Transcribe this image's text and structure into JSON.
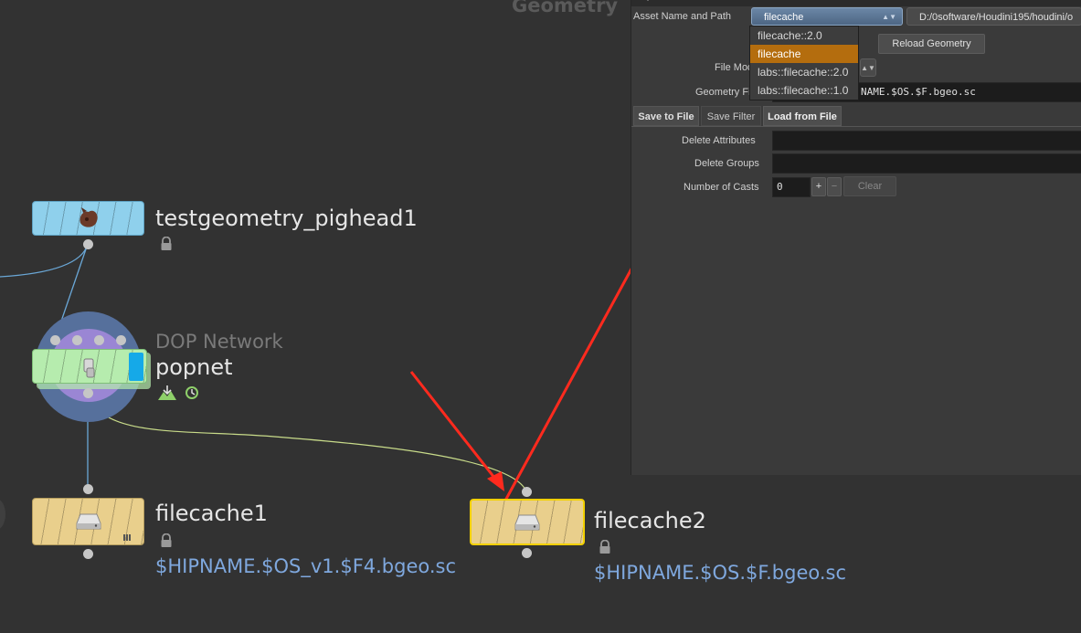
{
  "header_title": "Geometry",
  "nodes": {
    "testgeometry": {
      "name": "testgeometry_pighead1"
    },
    "popnet": {
      "type": "DOP Network",
      "name": "popnet"
    },
    "filecache1": {
      "name": "filecache1",
      "path": "$HIPNAME.$OS_v1.$F4.bgeo.sc"
    },
    "filecache2": {
      "name": "filecache2",
      "path": "$HIPNAME.$OS.$F.bgeo.sc"
    }
  },
  "params": {
    "asset_label": "Asset Name and Path",
    "asset_value": "filecache",
    "asset_path": "D:/0software/Houdini195/houdini/o",
    "reload_label": "Reload Geometry",
    "file_mode_label": "File Mod",
    "geometry_file_label": "Geometry Fi",
    "geometry_file_value": "NAME.$OS.$F.bgeo.sc",
    "tabs": [
      "Save to File",
      "Save Filter",
      "Load from File"
    ],
    "delete_attributes_label": "Delete Attributes",
    "delete_groups_label": "Delete Groups",
    "number_of_casts_label": "Number of Casts",
    "number_of_casts_value": "0",
    "plus_label": "+",
    "minus_label": "−",
    "clear_label": "Clear"
  },
  "dropdown": {
    "options": [
      "filecache::2.0",
      "filecache",
      "labs::filecache::2.0",
      "labs::filecache::1.0"
    ],
    "selected": "filecache"
  },
  "colors": {
    "background": "#323232",
    "testgeometry_node": "#8fd0ec",
    "popnet_node": "#b6ecae",
    "filecache_node": "#e9cf8c",
    "selection_outline": "#f2d000",
    "dropdown_selected": "#b46d0e",
    "annotation_arrow": "#ff2a1e",
    "path_text": "#7fa8de"
  }
}
